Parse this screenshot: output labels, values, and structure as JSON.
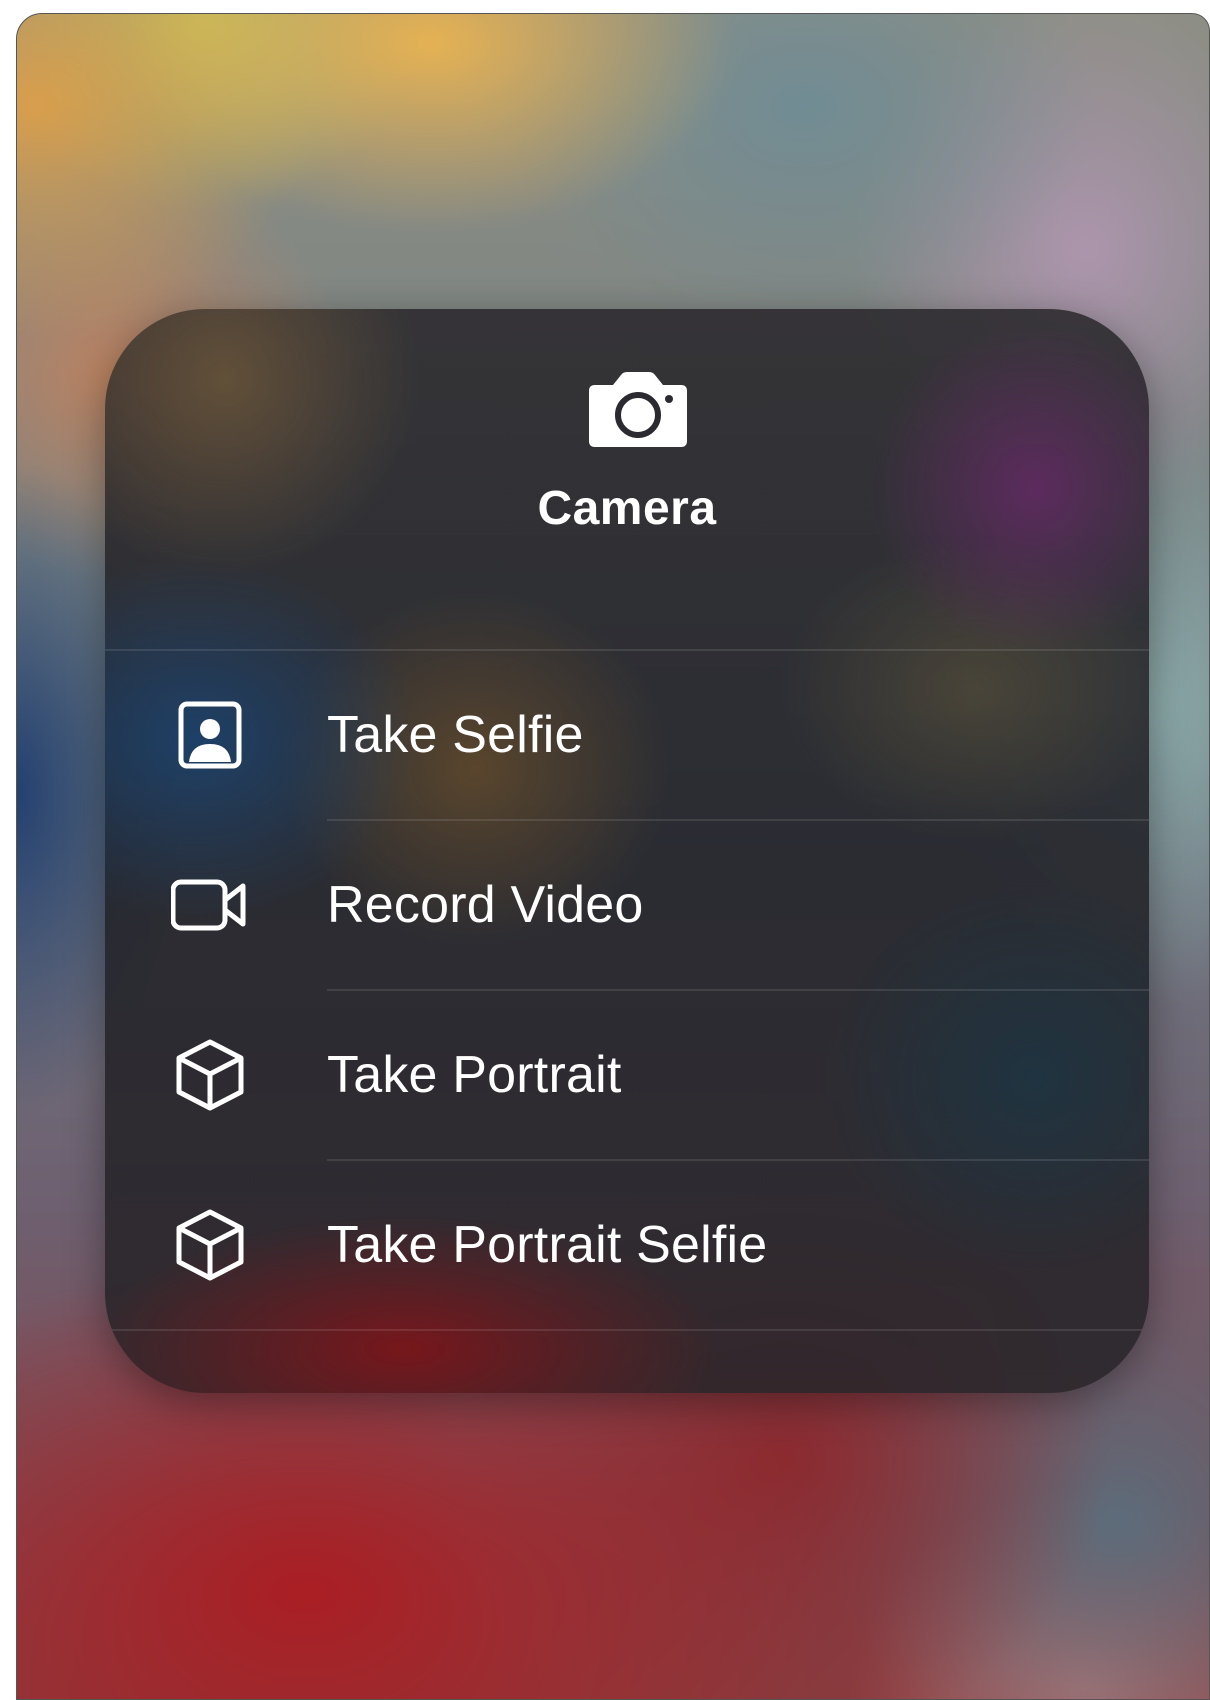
{
  "panel": {
    "title": "Camera",
    "header_icon": "camera-icon"
  },
  "menu": {
    "items": [
      {
        "label": "Take Selfie",
        "icon": "selfie-icon"
      },
      {
        "label": "Record Video",
        "icon": "video-camera-icon"
      },
      {
        "label": "Take Portrait",
        "icon": "cube-icon"
      },
      {
        "label": "Take Portrait Selfie",
        "icon": "cube-icon"
      }
    ]
  },
  "colors": {
    "text": "#ffffff",
    "panel_background": "#26272c",
    "wallpaper_red": "#a21e25",
    "wallpaper_gold": "#e1ab52"
  }
}
